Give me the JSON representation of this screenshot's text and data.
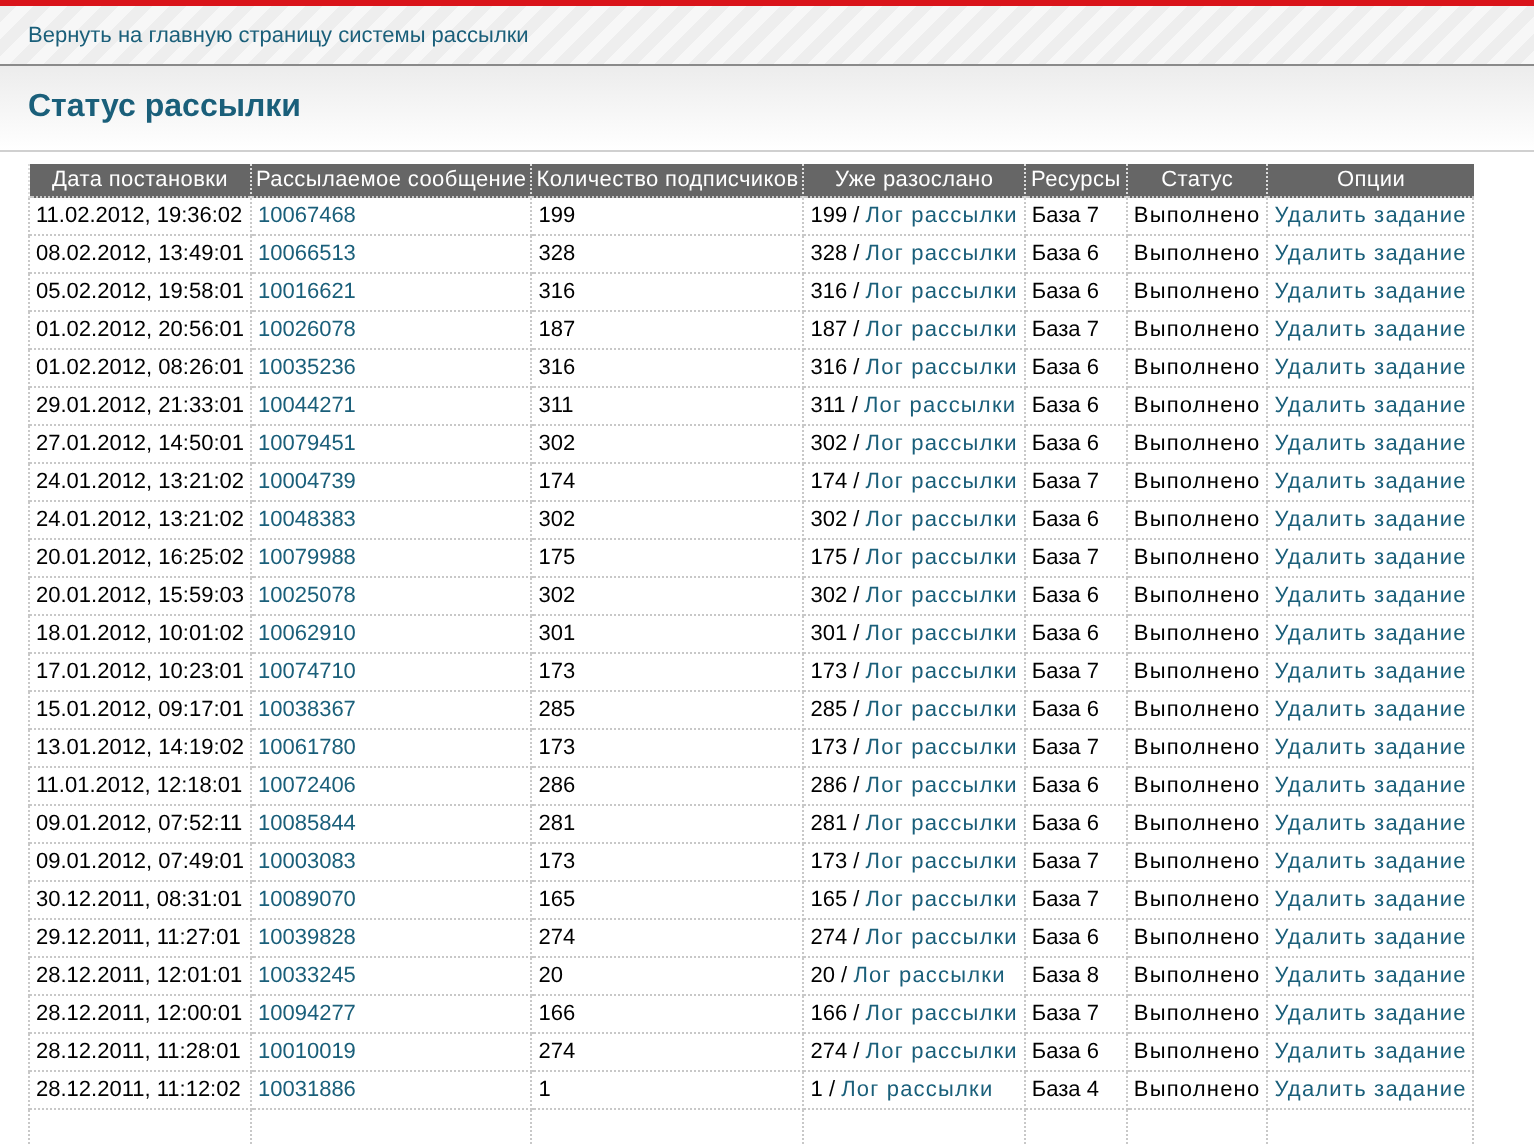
{
  "back_link": "Вернуть на главную страницу системы рассылки",
  "title": "Статус рассылки",
  "table": {
    "columns": [
      "Дата постановки",
      "Рассылаемое сообщение",
      "Количество подписчиков",
      "Уже разослано",
      "Ресурсы",
      "Статус",
      "Опции"
    ],
    "rows": [
      {
        "date": "11.02.2012, 19:36:02",
        "message": "10067468",
        "subscribers": "199",
        "sent": "199 /",
        "log": "Лог рассылки",
        "resource": "База 7",
        "status": "Выполнено",
        "option": "Удалить задание"
      },
      {
        "date": "08.02.2012, 13:49:01",
        "message": "10066513",
        "subscribers": "328",
        "sent": "328 /",
        "log": "Лог рассылки",
        "resource": "База 6",
        "status": "Выполнено",
        "option": "Удалить задание"
      },
      {
        "date": "05.02.2012, 19:58:01",
        "message": "10016621",
        "subscribers": "316",
        "sent": "316 /",
        "log": "Лог рассылки",
        "resource": "База 6",
        "status": "Выполнено",
        "option": "Удалить задание"
      },
      {
        "date": "01.02.2012, 20:56:01",
        "message": "10026078",
        "subscribers": "187",
        "sent": "187 /",
        "log": "Лог рассылки",
        "resource": "База 7",
        "status": "Выполнено",
        "option": "Удалить задание"
      },
      {
        "date": "01.02.2012, 08:26:01",
        "message": "10035236",
        "subscribers": "316",
        "sent": "316 /",
        "log": "Лог рассылки",
        "resource": "База 6",
        "status": "Выполнено",
        "option": "Удалить задание"
      },
      {
        "date": "29.01.2012, 21:33:01",
        "message": "10044271",
        "subscribers": "311",
        "sent": "311 /",
        "log": "Лог рассылки",
        "resource": "База 6",
        "status": "Выполнено",
        "option": "Удалить задание"
      },
      {
        "date": "27.01.2012, 14:50:01",
        "message": "10079451",
        "subscribers": "302",
        "sent": "302 /",
        "log": "Лог рассылки",
        "resource": "База 6",
        "status": "Выполнено",
        "option": "Удалить задание"
      },
      {
        "date": "24.01.2012, 13:21:02",
        "message": "10004739",
        "subscribers": "174",
        "sent": "174 /",
        "log": "Лог рассылки",
        "resource": "База 7",
        "status": "Выполнено",
        "option": "Удалить задание"
      },
      {
        "date": "24.01.2012, 13:21:02",
        "message": "10048383",
        "subscribers": "302",
        "sent": "302 /",
        "log": "Лог рассылки",
        "resource": "База 6",
        "status": "Выполнено",
        "option": "Удалить задание"
      },
      {
        "date": "20.01.2012, 16:25:02",
        "message": "10079988",
        "subscribers": "175",
        "sent": "175 /",
        "log": "Лог рассылки",
        "resource": "База 7",
        "status": "Выполнено",
        "option": "Удалить задание"
      },
      {
        "date": "20.01.2012, 15:59:03",
        "message": "10025078",
        "subscribers": "302",
        "sent": "302 /",
        "log": "Лог рассылки",
        "resource": "База 6",
        "status": "Выполнено",
        "option": "Удалить задание"
      },
      {
        "date": "18.01.2012, 10:01:02",
        "message": "10062910",
        "subscribers": "301",
        "sent": "301 /",
        "log": "Лог рассылки",
        "resource": "База 6",
        "status": "Выполнено",
        "option": "Удалить задание"
      },
      {
        "date": "17.01.2012, 10:23:01",
        "message": "10074710",
        "subscribers": "173",
        "sent": "173 /",
        "log": "Лог рассылки",
        "resource": "База 7",
        "status": "Выполнено",
        "option": "Удалить задание"
      },
      {
        "date": "15.01.2012, 09:17:01",
        "message": "10038367",
        "subscribers": "285",
        "sent": "285 /",
        "log": "Лог рассылки",
        "resource": "База 6",
        "status": "Выполнено",
        "option": "Удалить задание"
      },
      {
        "date": "13.01.2012, 14:19:02",
        "message": "10061780",
        "subscribers": "173",
        "sent": "173 /",
        "log": "Лог рассылки",
        "resource": "База 7",
        "status": "Выполнено",
        "option": "Удалить задание"
      },
      {
        "date": "11.01.2012, 12:18:01",
        "message": "10072406",
        "subscribers": "286",
        "sent": "286 /",
        "log": "Лог рассылки",
        "resource": "База 6",
        "status": "Выполнено",
        "option": "Удалить задание"
      },
      {
        "date": "09.01.2012, 07:52:11",
        "message": "10085844",
        "subscribers": "281",
        "sent": "281 /",
        "log": "Лог рассылки",
        "resource": "База 6",
        "status": "Выполнено",
        "option": "Удалить задание"
      },
      {
        "date": "09.01.2012, 07:49:01",
        "message": "10003083",
        "subscribers": "173",
        "sent": "173 /",
        "log": "Лог рассылки",
        "resource": "База 7",
        "status": "Выполнено",
        "option": "Удалить задание"
      },
      {
        "date": "30.12.2011, 08:31:01",
        "message": "10089070",
        "subscribers": "165",
        "sent": "165 /",
        "log": "Лог рассылки",
        "resource": "База 7",
        "status": "Выполнено",
        "option": "Удалить задание"
      },
      {
        "date": "29.12.2011, 11:27:01",
        "message": "10039828",
        "subscribers": "274",
        "sent": "274 /",
        "log": "Лог рассылки",
        "resource": "База 6",
        "status": "Выполнено",
        "option": "Удалить задание"
      },
      {
        "date": "28.12.2011, 12:01:01",
        "message": "10033245",
        "subscribers": "20",
        "sent": "20 /",
        "log": "Лог рассылки",
        "resource": "База 8",
        "status": "Выполнено",
        "option": "Удалить задание"
      },
      {
        "date": "28.12.2011, 12:00:01",
        "message": "10094277",
        "subscribers": "166",
        "sent": "166 /",
        "log": "Лог рассылки",
        "resource": "База 7",
        "status": "Выполнено",
        "option": "Удалить задание"
      },
      {
        "date": "28.12.2011, 11:28:01",
        "message": "10010019",
        "subscribers": "274",
        "sent": "274 /",
        "log": "Лог рассылки",
        "resource": "База 6",
        "status": "Выполнено",
        "option": "Удалить задание"
      },
      {
        "date": "28.12.2011, 11:12:02",
        "message": "10031886",
        "subscribers": "1",
        "sent": "1 /",
        "log": "Лог рассылки",
        "resource": "База 4",
        "status": "Выполнено",
        "option": "Удалить задание"
      }
    ]
  }
}
